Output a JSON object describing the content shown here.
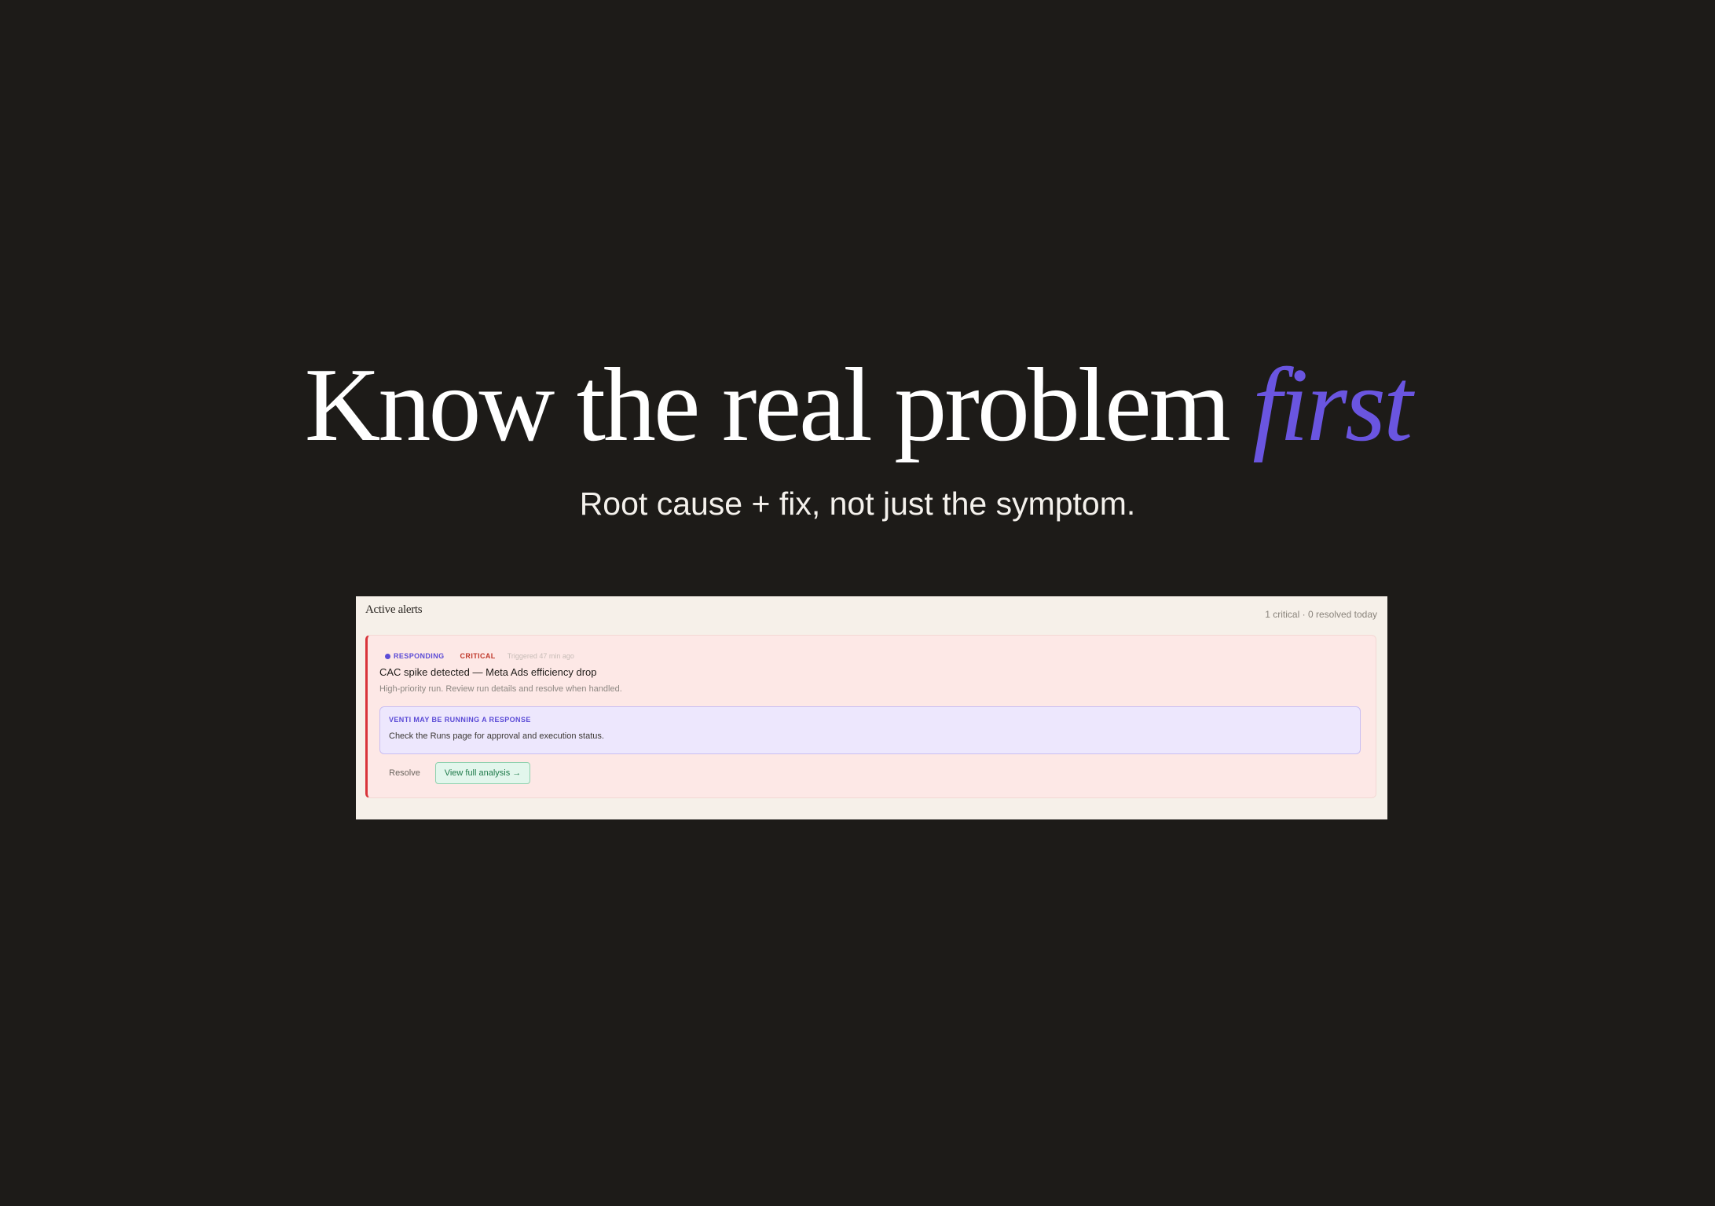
{
  "hero": {
    "headline": "Know the real problem ",
    "headline_accent": "first",
    "subheadline": "Root cause + fix, not just the symptom."
  },
  "panel": {
    "title": "Active alerts",
    "summary": "1 critical · 0 resolved today"
  },
  "alert": {
    "status_badge": "RESPONDING",
    "severity_badge": "CRITICAL",
    "triggered": "Triggered 47 min ago",
    "title": "CAC spike detected — Meta Ads efficiency drop",
    "description": "High-priority run. Review run details and resolve when handled.",
    "response_label": "VENTI MAY BE RUNNING A RESPONSE",
    "response_text": "Check the Runs page for approval and execution status.",
    "resolve_label": "Resolve",
    "analysis_label": "View full analysis →"
  },
  "colors": {
    "background": "#1d1b18",
    "accent": "#6a55e0",
    "critical": "#d8343a",
    "success": "#1f7a4a"
  }
}
